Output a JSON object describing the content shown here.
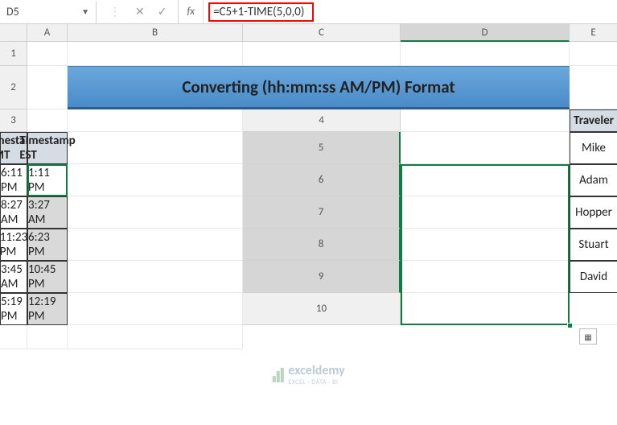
{
  "nameBox": "D5",
  "fxLabel": "fx",
  "formula": "=C5+1-TIME(5,0,0)",
  "cols": {
    "A": "A",
    "B": "B",
    "C": "C",
    "D": "D",
    "E": "E"
  },
  "rows": {
    "r1": "1",
    "r2": "2",
    "r3": "3",
    "r4": "4",
    "r5": "5",
    "r6": "6",
    "r7": "7",
    "r8": "8",
    "r9": "9",
    "r10": "10"
  },
  "title": "Converting (hh:mm:ss AM/PM) Format",
  "headers": {
    "traveler": "Traveler",
    "gmt": "Timestamp GMT",
    "est": "Timestamp EST"
  },
  "data": [
    {
      "name": "Mike",
      "gmt": "6:11 PM",
      "est": "1:11 PM"
    },
    {
      "name": "Adam",
      "gmt": "8:27 AM",
      "est": "3:27 AM"
    },
    {
      "name": "Hopper",
      "gmt": "11:23 PM",
      "est": "6:23 PM"
    },
    {
      "name": "Stuart",
      "gmt": "3:45 AM",
      "est": "10:45 PM"
    },
    {
      "name": "David",
      "gmt": "5:19 PM",
      "est": "12:19 PM"
    }
  ],
  "watermark": {
    "name": "exceldemy",
    "sub": "EXCEL · DATA · BI"
  }
}
